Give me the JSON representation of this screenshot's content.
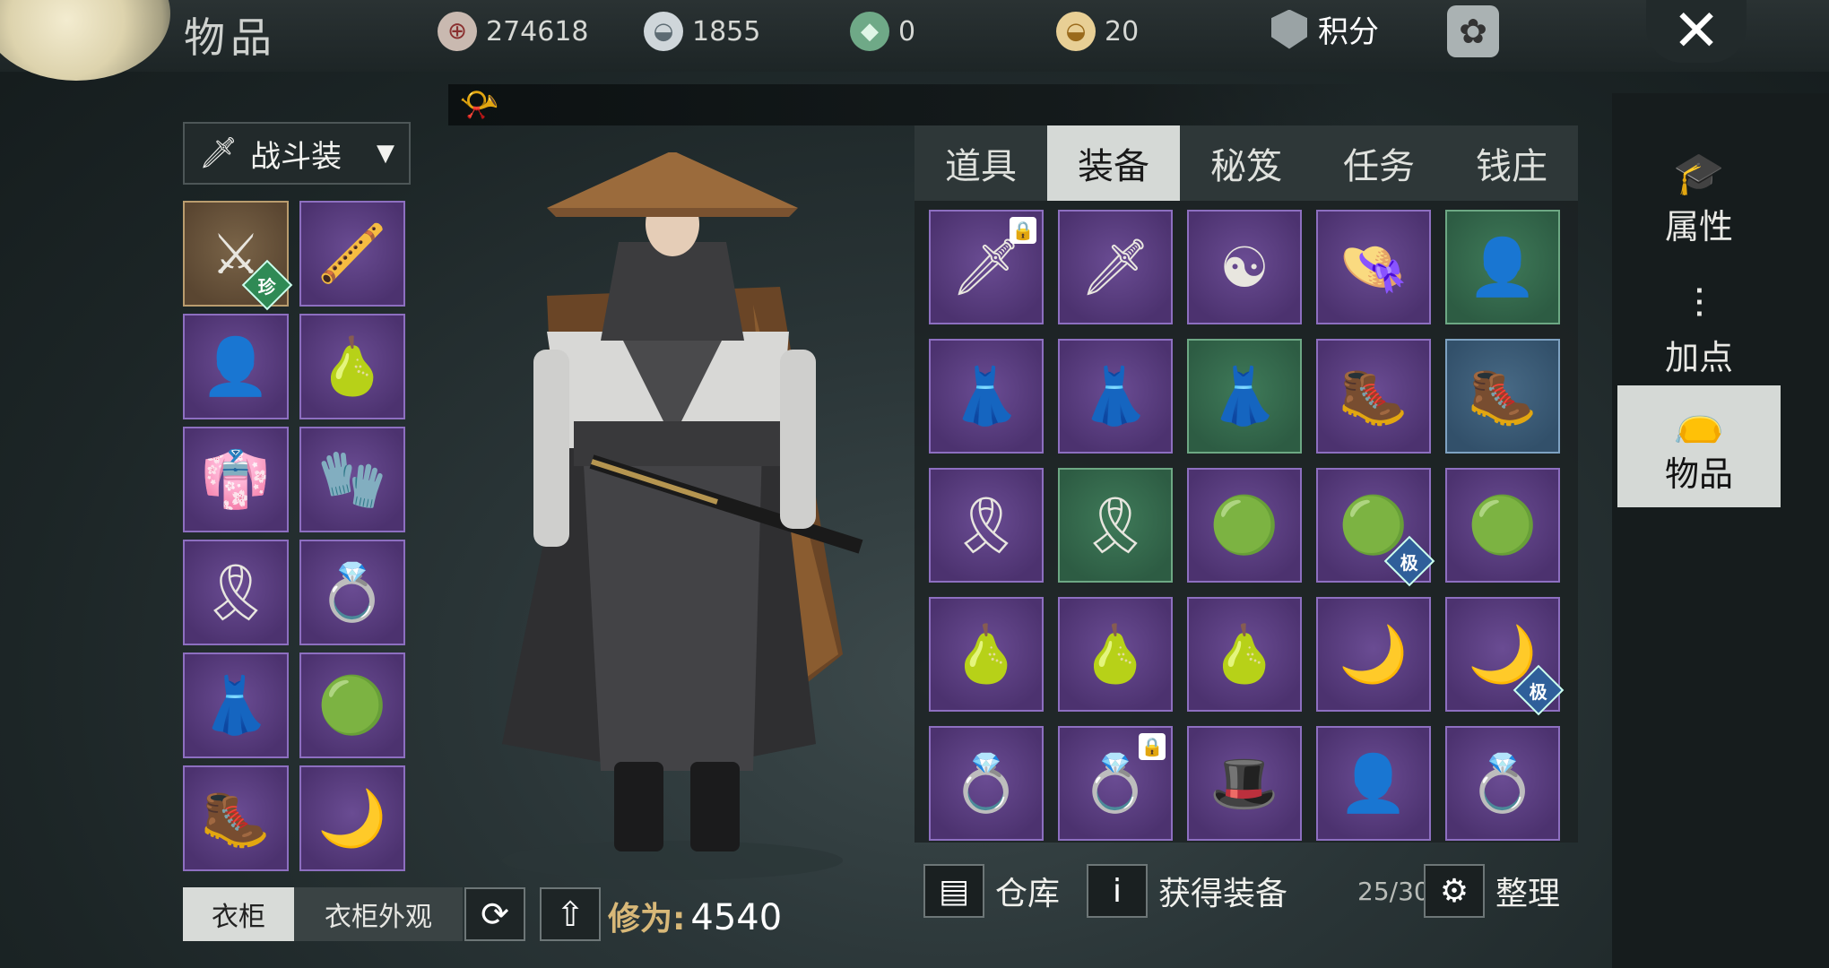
{
  "header": {
    "title": "物品",
    "currencies": [
      {
        "icon": "copper-coin-icon",
        "glyph": "⊕",
        "value": "274618"
      },
      {
        "icon": "silver-ingot-icon",
        "glyph": "◒",
        "value": "1855"
      },
      {
        "icon": "jade-ticket-icon",
        "glyph": "◆",
        "value": "0"
      },
      {
        "icon": "gold-ingot-icon",
        "glyph": "◒",
        "value": "20"
      }
    ],
    "points_label": "积分"
  },
  "equipped": {
    "outfit_label": "战斗装",
    "slots": [
      {
        "name": "weapon-spear",
        "glyph": "⚔",
        "rarity": "gold",
        "badge": "珍"
      },
      {
        "name": "weapon-flute",
        "glyph": "🪈",
        "rarity": "purple"
      },
      {
        "name": "face-portrait",
        "glyph": "👤",
        "rarity": "purple"
      },
      {
        "name": "jade-pendant",
        "glyph": "🍐",
        "rarity": "purple"
      },
      {
        "name": "upper-armor",
        "glyph": "👘",
        "rarity": "purple"
      },
      {
        "name": "gauntlet",
        "glyph": "🧤",
        "rarity": "purple"
      },
      {
        "name": "belt",
        "glyph": "🎗",
        "rarity": "purple"
      },
      {
        "name": "jade-bracelets",
        "glyph": "💍",
        "rarity": "purple"
      },
      {
        "name": "lower-skirt",
        "glyph": "👗",
        "rarity": "purple"
      },
      {
        "name": "jade-ring",
        "glyph": "🟢",
        "rarity": "purple"
      },
      {
        "name": "boots",
        "glyph": "🥾",
        "rarity": "purple"
      },
      {
        "name": "crescent-pendant",
        "glyph": "🌙",
        "rarity": "purple"
      }
    ]
  },
  "bottom_left": {
    "wardrobe_tab": "衣柜",
    "wardrobe_look_tab": "衣柜外观",
    "cultivation_label": "修为:",
    "cultivation_value": "4540"
  },
  "bag": {
    "tabs": [
      "道具",
      "装备",
      "秘笈",
      "任务",
      "钱庄"
    ],
    "active_tab": 1,
    "items": [
      {
        "name": "spear",
        "glyph": "🗡",
        "rarity": "purple",
        "lock": true
      },
      {
        "name": "golden-sword",
        "glyph": "🗡",
        "rarity": "purple"
      },
      {
        "name": "taiji-bracer",
        "glyph": "☯",
        "rarity": "purple"
      },
      {
        "name": "straw-hat-head",
        "glyph": "👒",
        "rarity": "purple"
      },
      {
        "name": "face-head",
        "glyph": "👤",
        "rarity": "green"
      },
      {
        "name": "blue-skirt",
        "glyph": "👗",
        "rarity": "purple"
      },
      {
        "name": "white-skirt",
        "glyph": "👗",
        "rarity": "purple"
      },
      {
        "name": "blue-robe-skirt",
        "glyph": "👗",
        "rarity": "green"
      },
      {
        "name": "armored-boots",
        "glyph": "🥾",
        "rarity": "purple"
      },
      {
        "name": "steel-boots",
        "glyph": "🥾",
        "rarity": "blue"
      },
      {
        "name": "iron-belt",
        "glyph": "🎗",
        "rarity": "purple"
      },
      {
        "name": "jeweled-belt",
        "glyph": "🎗",
        "rarity": "green"
      },
      {
        "name": "jade-ring-1",
        "glyph": "🟢",
        "rarity": "purple"
      },
      {
        "name": "jade-ring-2",
        "glyph": "🟢",
        "rarity": "purple",
        "badge": "极"
      },
      {
        "name": "jade-ring-3",
        "glyph": "🟢",
        "rarity": "purple"
      },
      {
        "name": "jade-pendant-1",
        "glyph": "🍐",
        "rarity": "purple"
      },
      {
        "name": "jade-pendant-2",
        "glyph": "🍐",
        "rarity": "purple"
      },
      {
        "name": "jade-pendant-3",
        "glyph": "🍐",
        "rarity": "purple"
      },
      {
        "name": "crescent-pendant-1",
        "glyph": "🌙",
        "rarity": "purple"
      },
      {
        "name": "crescent-pendant-2",
        "glyph": "🌙",
        "rarity": "purple",
        "badge": "极"
      },
      {
        "name": "jade-bracelets-1",
        "glyph": "💍",
        "rarity": "purple"
      },
      {
        "name": "white-bracelets",
        "glyph": "💍",
        "rarity": "purple",
        "lock": true
      },
      {
        "name": "dark-hat-head",
        "glyph": "🎩",
        "rarity": "purple"
      },
      {
        "name": "face-head-2",
        "glyph": "👤",
        "rarity": "purple"
      },
      {
        "name": "jade-bracelets-2",
        "glyph": "💍",
        "rarity": "purple"
      }
    ],
    "warehouse_label": "仓库",
    "obtain_label": "获得装备",
    "capacity": "25/30",
    "sort_label": "整理"
  },
  "nav": {
    "attributes": "属性",
    "add_points": "加点",
    "items": "物品"
  }
}
